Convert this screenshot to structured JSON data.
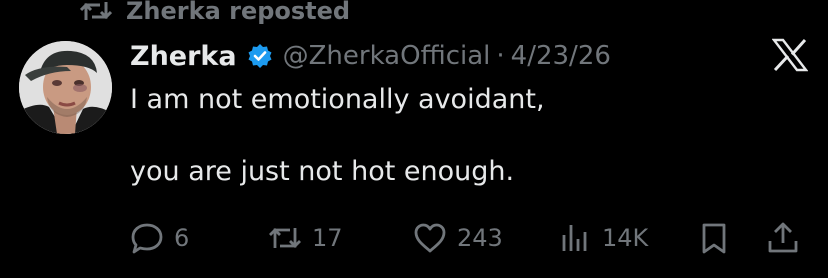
{
  "repost": {
    "label": "Zherka reposted",
    "icon": "repost-icon"
  },
  "author": {
    "display_name": "Zherka",
    "handle": "@ZherkaOfficial",
    "separator": "·",
    "date": "4/23/26",
    "verified": true,
    "verified_color": "#1d9bf0"
  },
  "tweet": {
    "text": "I am not emotionally avoidant,\n\nyou are just not hot enough."
  },
  "actions": {
    "replies": "6",
    "reposts": "17",
    "likes": "243",
    "views": "14K"
  },
  "colors": {
    "background": "#000000",
    "text": "#e7e9ea",
    "muted": "#71767b",
    "accent": "#1d9bf0"
  }
}
